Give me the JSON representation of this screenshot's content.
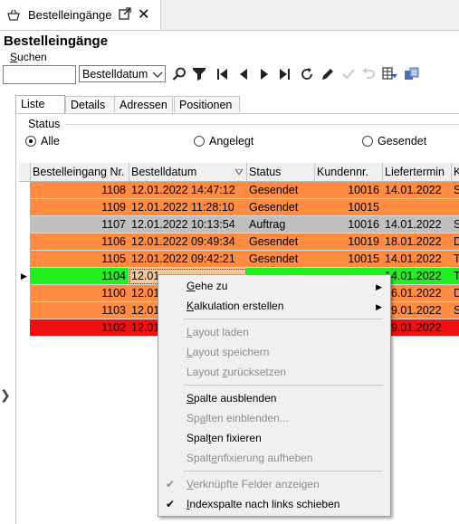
{
  "tab": {
    "title": "Bestelleingänge",
    "close": "✕"
  },
  "header": {
    "title": "Bestelleingänge",
    "search_label_u": "S",
    "search_label_rest": "uchen"
  },
  "search": {
    "input_value": "",
    "field": "Bestelldatum"
  },
  "subtabs": [
    "Liste",
    "Details",
    "Adressen",
    "Positionen"
  ],
  "status": {
    "label": "Status",
    "options": [
      "Alle",
      "Angelegt",
      "Gesendet"
    ],
    "selected": "Alle"
  },
  "grid": {
    "columns": [
      "Bestelleingang Nr.",
      "Bestelldatum",
      "Status",
      "Kundennr.",
      "Liefertermin",
      "K"
    ],
    "rows": [
      {
        "nr": "1108",
        "datum": "12.01.2022 14:47:12",
        "status": "Gesendet",
        "kunde": "10016",
        "liefer": "14.01.2022",
        "k": "S",
        "color": "#ff8c42"
      },
      {
        "nr": "1109",
        "datum": "12.01.2022 11:28:10",
        "status": "Gesendet",
        "kunde": "10015",
        "liefer": "",
        "k": "",
        "color": "#ff8c42"
      },
      {
        "nr": "1107",
        "datum": "12.01.2022 10:13:54",
        "status": "Auftrag",
        "kunde": "10016",
        "liefer": "14.01.2022",
        "k": "S",
        "color": "#bfbfbf"
      },
      {
        "nr": "1106",
        "datum": "12.01.2022 09:49:34",
        "status": "Gesendet",
        "kunde": "10019",
        "liefer": "18.01.2022",
        "k": "D",
        "color": "#ff8c42"
      },
      {
        "nr": "1105",
        "datum": "12.01.2022 09:42:21",
        "status": "Gesendet",
        "kunde": "10015",
        "liefer": "14.01.2022",
        "k": "T",
        "color": "#ff8c42"
      },
      {
        "nr": "1104",
        "datum": "12.01",
        "status": "",
        "kunde": "",
        "liefer": "14.01.2022",
        "k": "T",
        "color": "#22ee22"
      },
      {
        "nr": "1100",
        "datum": "12.01",
        "status": "",
        "kunde": "",
        "liefer": "26.01.2022",
        "k": "D",
        "color": "#ff8c42"
      },
      {
        "nr": "1103",
        "datum": "12.01",
        "status": "",
        "kunde": "",
        "liefer": "19.01.2022",
        "k": "S",
        "color": "#ff8c42"
      },
      {
        "nr": "1102",
        "datum": "12.01",
        "status": "",
        "kunde": "",
        "liefer": "19.01.2022",
        "k": "",
        "color": "#ee1111"
      }
    ],
    "selected_row_index": 5
  },
  "context_menu": {
    "goto": {
      "u": "G",
      "rest": "ehe zu"
    },
    "kalkulation": {
      "u": "K",
      "rest": "alkulation erstellen"
    },
    "layout_laden": {
      "pre": "",
      "u": "L",
      "rest": "ayout laden"
    },
    "layout_speichern": {
      "pre": "",
      "u": "L",
      "rest": "ayout speichern"
    },
    "layout_reset": {
      "pre": "Layout ",
      "u": "z",
      "rest": "urücksetzen"
    },
    "spalte_ausblenden": {
      "pre": "",
      "u": "S",
      "rest": "palte ausblenden"
    },
    "spalten_einblenden": {
      "pre": "Sp",
      "u": "a",
      "rest": "lten einblenden..."
    },
    "spalten_fixieren": {
      "pre": "Spal",
      "u": "t",
      "rest": "en fixieren"
    },
    "spaltenfixierung": {
      "pre": "Spalt",
      "u": "e",
      "rest": "nfixierung aufheben"
    },
    "verknuepfte": {
      "pre": "",
      "u": "V",
      "rest": "erknüpfte Felder anzeigen"
    },
    "indexspalte": {
      "pre": "",
      "u": "I",
      "rest": "ndexspalte nach links schieben"
    }
  },
  "colors": {
    "orange": "#ff8c42",
    "gray": "#bfbfbf",
    "green": "#22ee22",
    "red": "#ee1111"
  }
}
